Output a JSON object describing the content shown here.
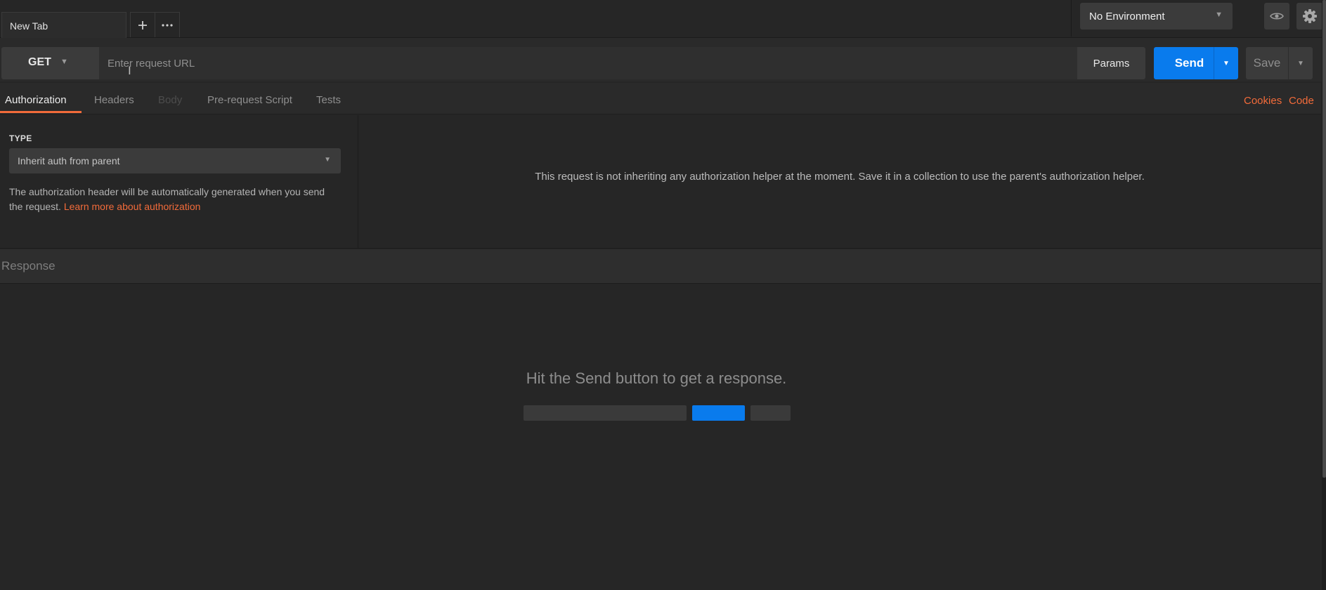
{
  "tabs": {
    "active_label": "New Tab",
    "new_tab_icon": "plus-icon",
    "more_icon": "more-horizontal-icon"
  },
  "environment": {
    "selected": "No Environment",
    "eye_icon": "eye-icon",
    "settings_icon": "gear-icon"
  },
  "request": {
    "method": "GET",
    "url_value": "",
    "url_placeholder": "Enter request URL",
    "params_label": "Params",
    "send_label": "Send",
    "save_label": "Save"
  },
  "request_tabs": {
    "items": [
      "Authorization",
      "Headers",
      "Body",
      "Pre-request Script",
      "Tests"
    ],
    "active": "Authorization",
    "cookies_label": "Cookies",
    "code_label": "Code"
  },
  "auth": {
    "type_heading": "TYPE",
    "type_selected": "Inherit auth from parent",
    "description": "The authorization header will be automatically generated when you send the request. ",
    "learn_more_link": "Learn more about authorization",
    "right_message": "This request is not inheriting any authorization helper at the moment. Save it in a collection to use the parent's authorization helper."
  },
  "response": {
    "title": "Response",
    "empty_message": "Hit the Send button to get a response."
  },
  "colors": {
    "accent": "#f26b3a",
    "primary": "#097bed",
    "background": "#262626"
  }
}
